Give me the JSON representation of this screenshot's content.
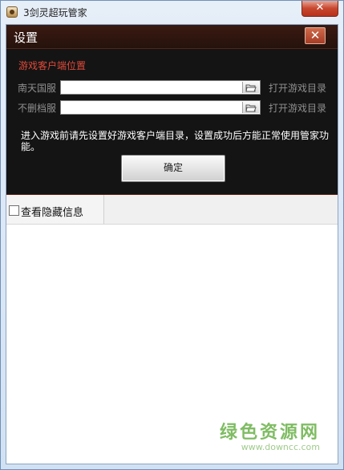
{
  "window": {
    "title": "3剑灵超玩管家",
    "close_glyph": "✕"
  },
  "dialog": {
    "title": "设置",
    "close_glyph": "✕",
    "section_label": "游戏客户端位置",
    "rows": [
      {
        "label": "南天国服",
        "value": "",
        "open_label": "打开游戏目录"
      },
      {
        "label": "不删档服",
        "value": "",
        "open_label": "打开游戏目录"
      }
    ],
    "notice": "进入游戏前请先设置好游戏客户端目录，设置成功后方能正常使用管家功能。",
    "confirm_label": "确定"
  },
  "options": {
    "show_hidden_label": "查看隐藏信息",
    "show_hidden_checked": false
  },
  "watermark": {
    "text": "绿色资源网",
    "url": "www.downcc.com"
  },
  "icons": {
    "app": "app-logo-icon",
    "folder": "folder-open-icon",
    "close": "close-icon"
  }
}
